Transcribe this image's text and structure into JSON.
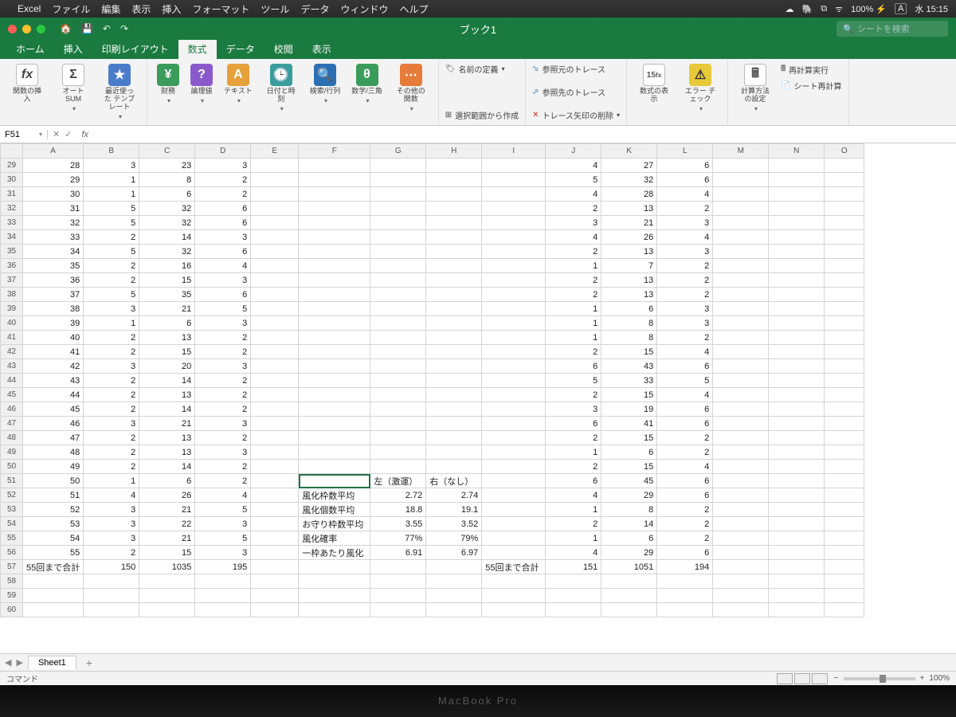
{
  "mac_menu": {
    "app": "Excel",
    "items": [
      "ファイル",
      "編集",
      "表示",
      "挿入",
      "フォーマット",
      "ツール",
      "データ",
      "ウィンドウ",
      "ヘルプ"
    ],
    "battery": "100%",
    "ime": "A",
    "clock": "水 15:15"
  },
  "titlebar": {
    "doc": "ブック1",
    "search_placeholder": "シートを検索"
  },
  "ribbon_tabs": [
    "ホーム",
    "挿入",
    "印刷レイアウト",
    "数式",
    "データ",
    "校閲",
    "表示"
  ],
  "active_tab_index": 3,
  "ribbon": {
    "g1_fx": "関数の挿入",
    "g1_sum": "オートSUM",
    "g1_recent": "最近使った\nテンプレート",
    "g2_fin": "財務",
    "g2_logic": "論理値",
    "g2_text": "テキスト",
    "g2_date": "日付と時刻",
    "g2_lookup": "検索/行列",
    "g2_math": "数学/三角",
    "g2_more": "その他の関数",
    "g3_define": "名前の定義",
    "g3_create": "選択範囲から作成",
    "g4_prec": "参照元のトレース",
    "g4_dep": "参照先のトレース",
    "g4_rem": "トレース矢印の削除",
    "g5_show": "数式の表示",
    "g5_err": "エラー チェック",
    "g6_calc": "計算方法の設定",
    "g6_recalc": "再計算実行",
    "g6_sheet": "シート再計算"
  },
  "namebox": "F51",
  "columns": [
    "A",
    "B",
    "C",
    "D",
    "E",
    "F",
    "G",
    "H",
    "I",
    "J",
    "K",
    "L",
    "M",
    "N",
    "O"
  ],
  "rows": [
    {
      "r": 29,
      "A": "28",
      "B": "3",
      "C": "23",
      "D": "3",
      "J": "4",
      "K": "27",
      "L": "6"
    },
    {
      "r": 30,
      "A": "29",
      "B": "1",
      "C": "8",
      "D": "2",
      "J": "5",
      "K": "32",
      "L": "6"
    },
    {
      "r": 31,
      "A": "30",
      "B": "1",
      "C": "6",
      "D": "2",
      "J": "4",
      "K": "28",
      "L": "4"
    },
    {
      "r": 32,
      "A": "31",
      "B": "5",
      "C": "32",
      "D": "6",
      "J": "2",
      "K": "13",
      "L": "2"
    },
    {
      "r": 33,
      "A": "32",
      "B": "5",
      "C": "32",
      "D": "6",
      "J": "3",
      "K": "21",
      "L": "3"
    },
    {
      "r": 34,
      "A": "33",
      "B": "2",
      "C": "14",
      "D": "3",
      "J": "4",
      "K": "26",
      "L": "4"
    },
    {
      "r": 35,
      "A": "34",
      "B": "5",
      "C": "32",
      "D": "6",
      "J": "2",
      "K": "13",
      "L": "3"
    },
    {
      "r": 36,
      "A": "35",
      "B": "2",
      "C": "16",
      "D": "4",
      "J": "1",
      "K": "7",
      "L": "2"
    },
    {
      "r": 37,
      "A": "36",
      "B": "2",
      "C": "15",
      "D": "3",
      "J": "2",
      "K": "13",
      "L": "2"
    },
    {
      "r": 38,
      "A": "37",
      "B": "5",
      "C": "35",
      "D": "6",
      "J": "2",
      "K": "13",
      "L": "2"
    },
    {
      "r": 39,
      "A": "38",
      "B": "3",
      "C": "21",
      "D": "5",
      "J": "1",
      "K": "6",
      "L": "3"
    },
    {
      "r": 40,
      "A": "39",
      "B": "1",
      "C": "6",
      "D": "3",
      "J": "1",
      "K": "8",
      "L": "3"
    },
    {
      "r": 41,
      "A": "40",
      "B": "2",
      "C": "13",
      "D": "2",
      "J": "1",
      "K": "8",
      "L": "2"
    },
    {
      "r": 42,
      "A": "41",
      "B": "2",
      "C": "15",
      "D": "2",
      "J": "2",
      "K": "15",
      "L": "4"
    },
    {
      "r": 43,
      "A": "42",
      "B": "3",
      "C": "20",
      "D": "3",
      "J": "6",
      "K": "43",
      "L": "6"
    },
    {
      "r": 44,
      "A": "43",
      "B": "2",
      "C": "14",
      "D": "2",
      "J": "5",
      "K": "33",
      "L": "5"
    },
    {
      "r": 45,
      "A": "44",
      "B": "2",
      "C": "13",
      "D": "2",
      "J": "2",
      "K": "15",
      "L": "4"
    },
    {
      "r": 46,
      "A": "45",
      "B": "2",
      "C": "14",
      "D": "2",
      "J": "3",
      "K": "19",
      "L": "6"
    },
    {
      "r": 47,
      "A": "46",
      "B": "3",
      "C": "21",
      "D": "3",
      "J": "6",
      "K": "41",
      "L": "6"
    },
    {
      "r": 48,
      "A": "47",
      "B": "2",
      "C": "13",
      "D": "2",
      "J": "2",
      "K": "15",
      "L": "2"
    },
    {
      "r": 49,
      "A": "48",
      "B": "2",
      "C": "13",
      "D": "3",
      "J": "1",
      "K": "6",
      "L": "2"
    },
    {
      "r": 50,
      "A": "49",
      "B": "2",
      "C": "14",
      "D": "2",
      "J": "2",
      "K": "15",
      "L": "4"
    },
    {
      "r": 51,
      "A": "50",
      "B": "1",
      "C": "6",
      "D": "2",
      "G": "左（激運）",
      "H": "右（なし）",
      "J": "6",
      "K": "45",
      "L": "6"
    },
    {
      "r": 52,
      "A": "51",
      "B": "4",
      "C": "26",
      "D": "4",
      "F": "風化枠数平均",
      "G": "2.72",
      "H": "2.74",
      "J": "4",
      "K": "29",
      "L": "6"
    },
    {
      "r": 53,
      "A": "52",
      "B": "3",
      "C": "21",
      "D": "5",
      "F": "風化個数平均",
      "G": "18.8",
      "H": "19.1",
      "J": "1",
      "K": "8",
      "L": "2"
    },
    {
      "r": 54,
      "A": "53",
      "B": "3",
      "C": "22",
      "D": "3",
      "F": "お守り枠数平均",
      "G": "3.55",
      "H": "3.52",
      "J": "2",
      "K": "14",
      "L": "2"
    },
    {
      "r": 55,
      "A": "54",
      "B": "3",
      "C": "21",
      "D": "5",
      "F": "風化確率",
      "G": "77%",
      "H": "79%",
      "J": "1",
      "K": "6",
      "L": "2"
    },
    {
      "r": 56,
      "A": "55",
      "B": "2",
      "C": "15",
      "D": "3",
      "F": "一枠あたり風化",
      "G": "6.91",
      "H": "6.97",
      "J": "4",
      "K": "29",
      "L": "6"
    },
    {
      "r": 57,
      "A": "55回まで合計",
      "B": "150",
      "C": "1035",
      "D": "195",
      "I": "55回まで合計",
      "J": "151",
      "K": "1051",
      "L": "194"
    },
    {
      "r": 58
    },
    {
      "r": 59
    },
    {
      "r": 60
    }
  ],
  "selected_cell": {
    "row": 51,
    "col": "F"
  },
  "textcols": [
    "F",
    "G_51",
    "H_51",
    "A_57",
    "I_57"
  ],
  "sheet": {
    "name": "Sheet1"
  },
  "statusbar": {
    "mode": "コマンド",
    "zoom": "100%"
  },
  "chin": "MacBook Pro"
}
